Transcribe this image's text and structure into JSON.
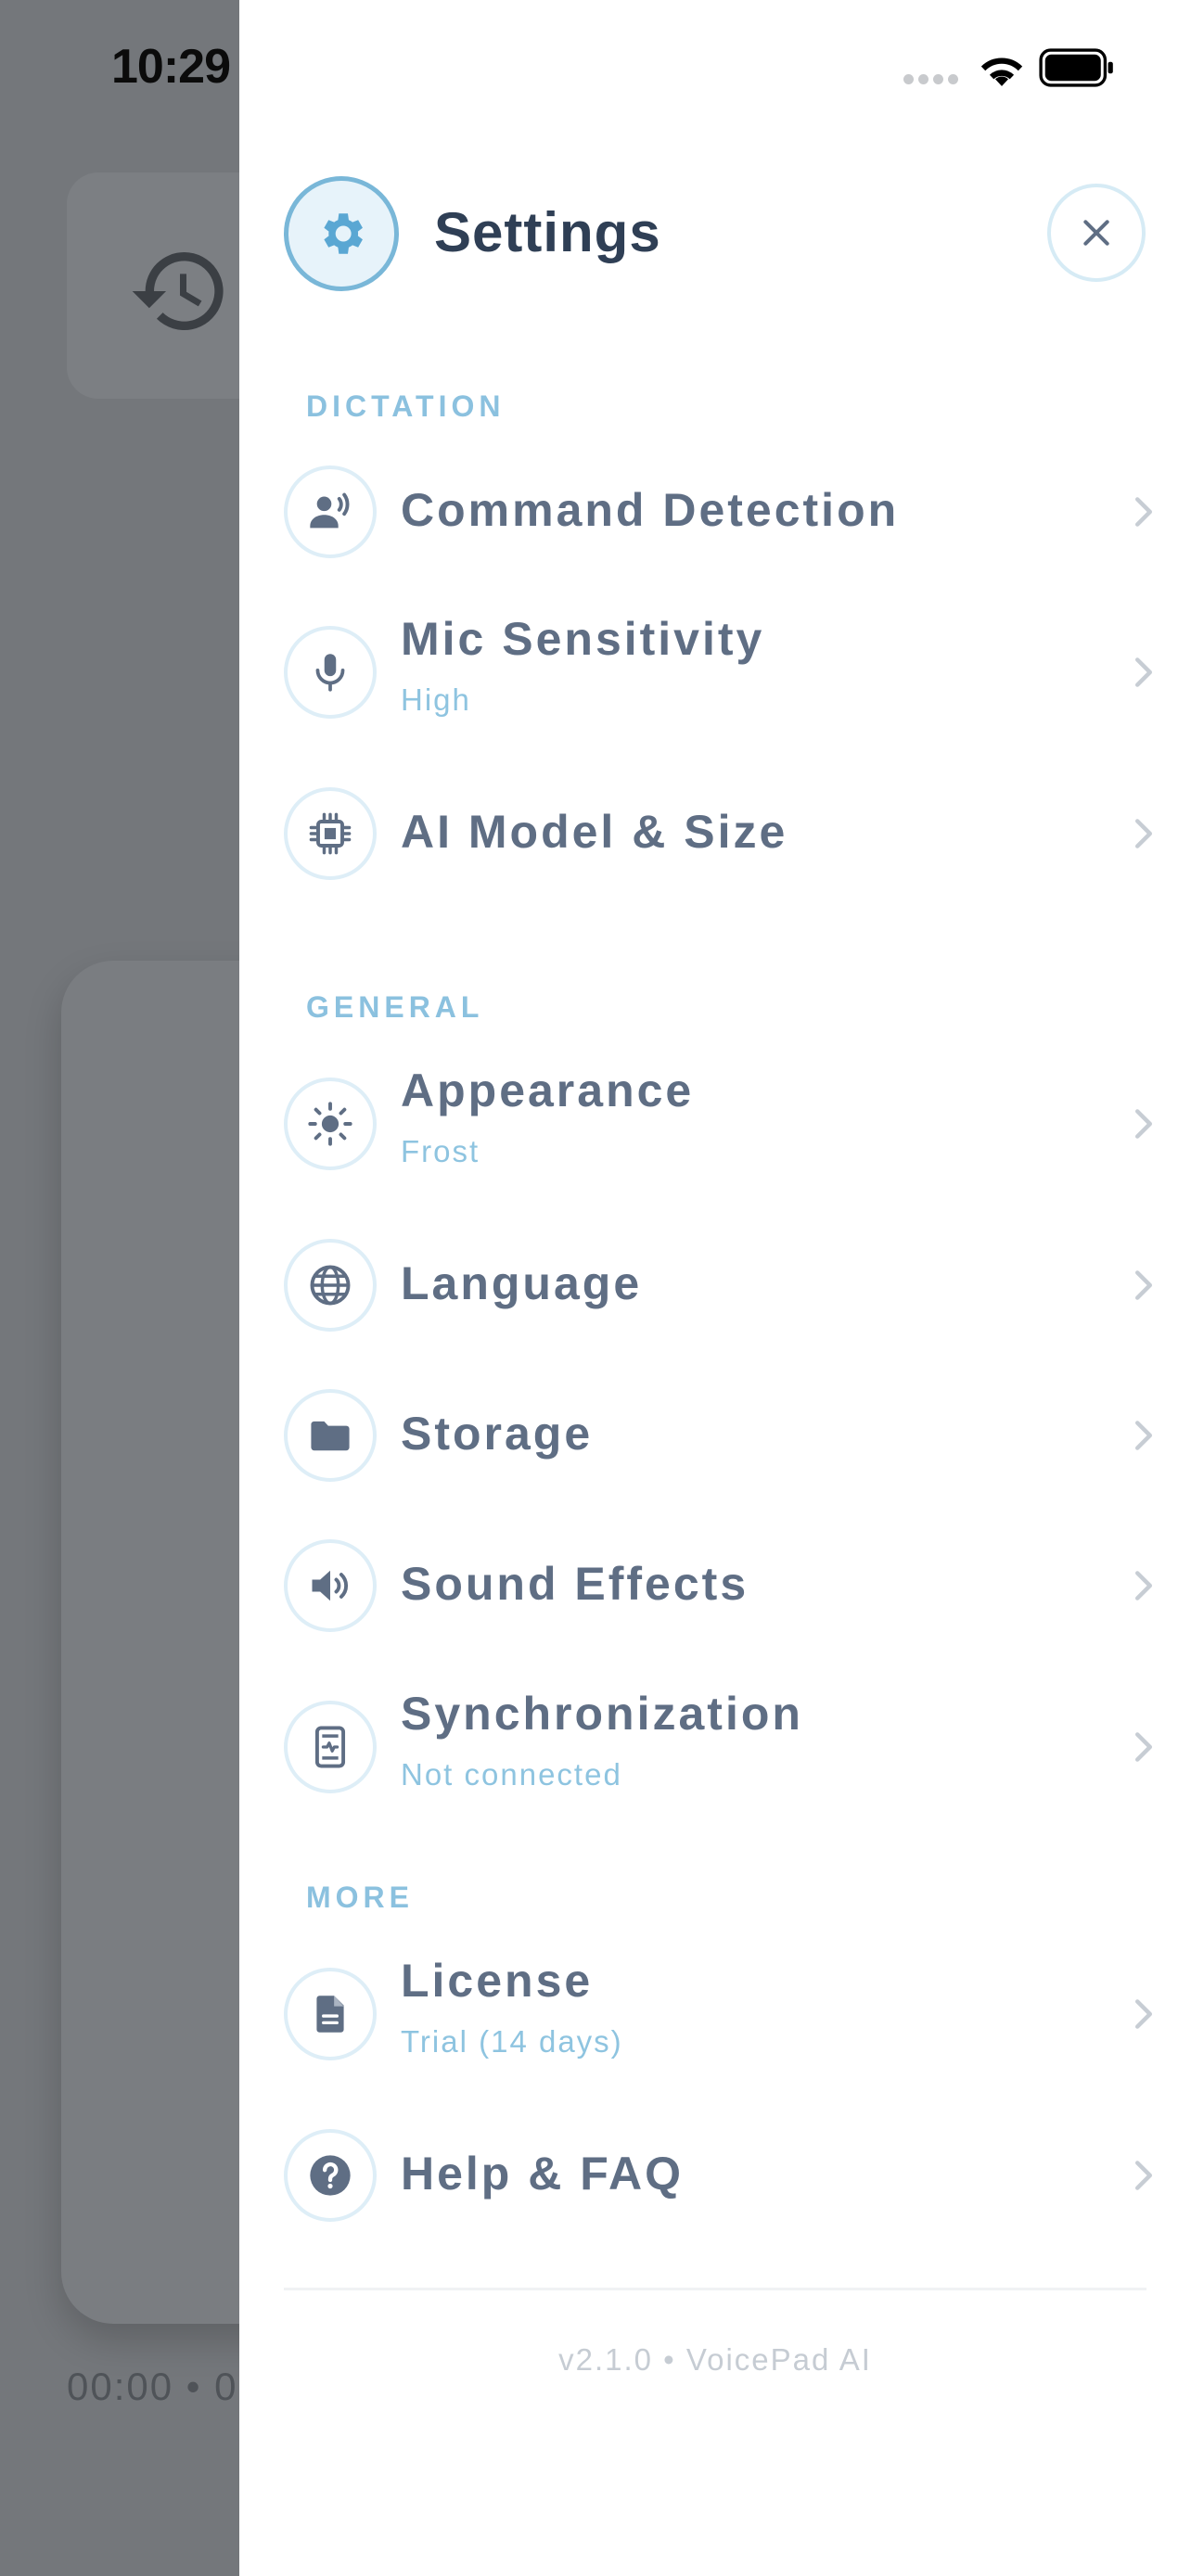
{
  "status_bar": {
    "time": "10:29"
  },
  "background": {
    "timer_text": "00:00 • 0"
  },
  "drawer": {
    "title": "Settings",
    "version_text": "v2.1.0 • VoicePad AI",
    "sections": {
      "dictation": {
        "label": "DICTATION",
        "items": [
          {
            "label": "Command Detection",
            "sub": "",
            "icon": "voice-person-icon"
          },
          {
            "label": "Mic Sensitivity",
            "sub": "High",
            "icon": "microphone-icon"
          },
          {
            "label": "AI Model & Size",
            "sub": "",
            "icon": "chip-icon"
          }
        ]
      },
      "general": {
        "label": "GENERAL",
        "items": [
          {
            "label": "Appearance",
            "sub": "Frost",
            "icon": "sun-icon"
          },
          {
            "label": "Language",
            "sub": "",
            "icon": "globe-icon"
          },
          {
            "label": "Storage",
            "sub": "",
            "icon": "folder-icon"
          },
          {
            "label": "Sound Effects",
            "sub": "",
            "icon": "speaker-icon"
          },
          {
            "label": "Synchronization",
            "sub": "Not connected",
            "icon": "sync-device-icon"
          }
        ]
      },
      "more": {
        "label": "MORE",
        "items": [
          {
            "label": "License",
            "sub": "Trial (14 days)",
            "icon": "document-icon"
          },
          {
            "label": "Help & FAQ",
            "sub": "",
            "icon": "help-icon"
          }
        ]
      }
    }
  },
  "colors": {
    "accent": "#79b7d8",
    "title": "#2f3f55",
    "row_label": "#5f6e84",
    "sub_label": "#8ec4e0",
    "scrim": "#74777b"
  }
}
